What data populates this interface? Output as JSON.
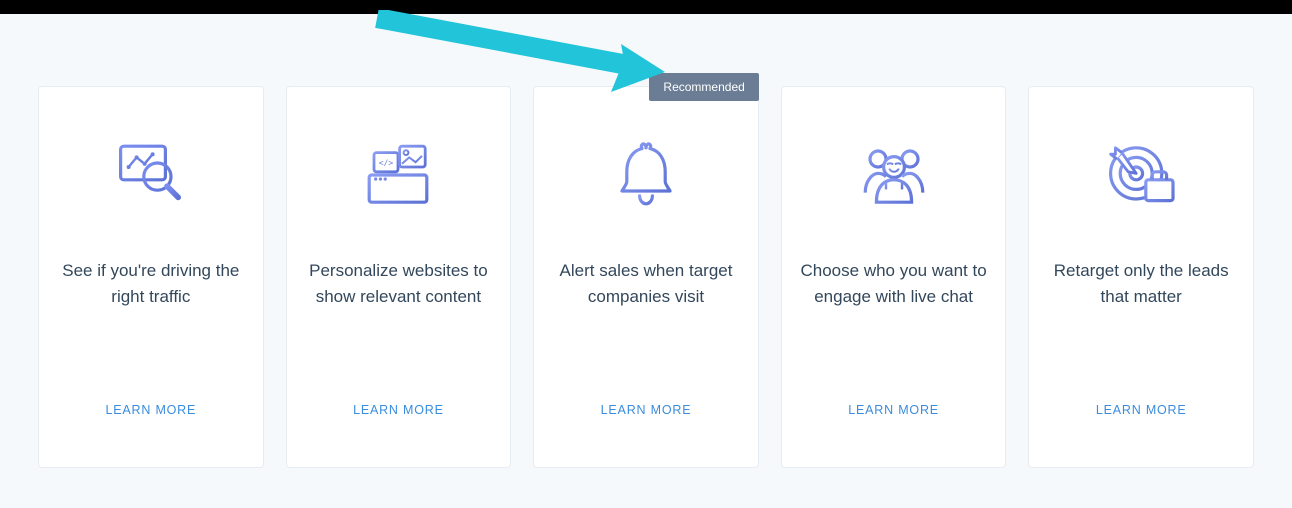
{
  "badge": "Recommended",
  "learn_more_label": "LEARN MORE",
  "cards": [
    {
      "title": "See if you're driving the right traffic"
    },
    {
      "title": "Personalize websites to show relevant content"
    },
    {
      "title": "Alert sales when target companies visit",
      "recommended": true
    },
    {
      "title": "Choose who you want to engage with live chat"
    },
    {
      "title": "Retarget only the leads that matter"
    }
  ]
}
